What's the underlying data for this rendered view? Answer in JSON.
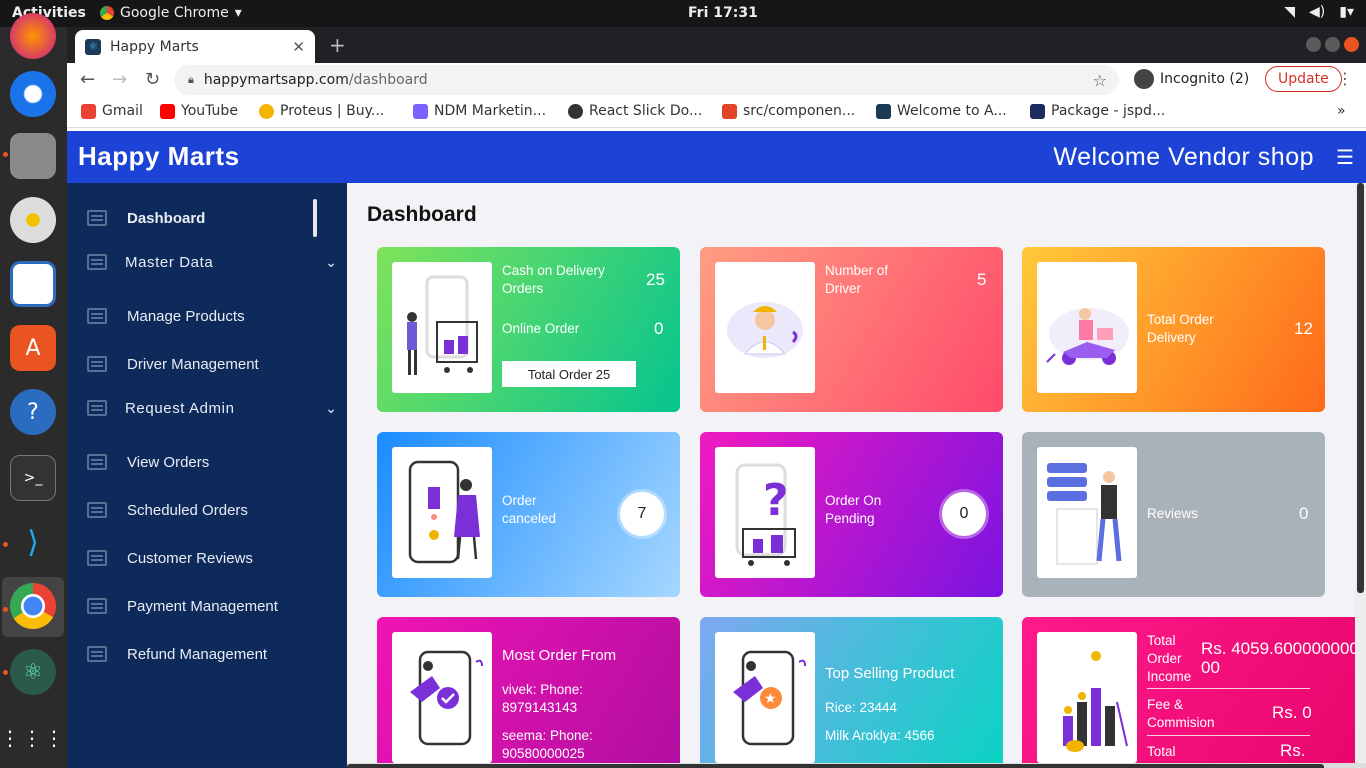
{
  "system": {
    "activities": "Activities",
    "app_name": "Google Chrome",
    "clock": "Fri 17:31"
  },
  "browser": {
    "tab_title": "Happy Marts",
    "url_domain": "happymartsapp.com",
    "url_path": "/dashboard",
    "incognito": "Incognito (2)",
    "update": "Update",
    "bookmarks": [
      {
        "label": "Gmail",
        "color": "#ea4335"
      },
      {
        "label": "YouTube",
        "color": "#ff0000"
      },
      {
        "label": "Proteus | Buy...",
        "color": "#f4b400"
      },
      {
        "label": "NDM Marketin...",
        "color": "#7b61ff"
      },
      {
        "label": "React Slick Do...",
        "color": "#333333"
      },
      {
        "label": "src/componen...",
        "color": "#e24329"
      },
      {
        "label": "Welcome to A...",
        "color": "#1b3a55"
      },
      {
        "label": "Package - jspd...",
        "color": "#1d2b5e"
      }
    ]
  },
  "header": {
    "brand": "Happy Marts",
    "welcome": "Welcome Vendor shop",
    "bg": "#1d42d6"
  },
  "sidebar": {
    "items": [
      {
        "label": "Dashboard"
      },
      {
        "label": "Master Data"
      },
      {
        "label": "Manage Products"
      },
      {
        "label": "Driver Management"
      },
      {
        "label": "Request Admin"
      },
      {
        "label": "View Orders"
      },
      {
        "label": "Scheduled Orders"
      },
      {
        "label": "Customer Reviews"
      },
      {
        "label": "Payment Management"
      },
      {
        "label": "Refund Management"
      }
    ],
    "bg": "#0e2a5a"
  },
  "main": {
    "title": "Dashboard",
    "cards": {
      "cod": {
        "label": "Cash on Delivery Orders",
        "value": "25",
        "online_label": "Online Order",
        "online_value": "0",
        "total_button": "Total Order 25"
      },
      "drivers": {
        "label": "Number of Driver",
        "value": "5"
      },
      "delivery": {
        "label": "Total Order Delivery",
        "value": "12"
      },
      "canceled": {
        "label": "Order canceled",
        "value": "7"
      },
      "pending": {
        "label": "Order On Pending",
        "value": "0"
      },
      "reviews": {
        "label": "Reviews",
        "value": "0"
      },
      "most_order": {
        "title": "Most Order From",
        "line1": "vivek: Phone:",
        "line2": "8979143143",
        "line3": "seema: Phone:",
        "line4": "90580000025"
      },
      "top_selling": {
        "title": "Top Selling Product",
        "line1": "Rice: 23444",
        "line2": "Milk Aroklya: 4566"
      },
      "income": {
        "label": "Total Order Income",
        "value": "Rs. 4059.60000000000",
        "fee_label": "Fee & Commision",
        "fee_value": "Rs. 0",
        "total_label": "Total",
        "total_value": "Rs."
      }
    }
  }
}
